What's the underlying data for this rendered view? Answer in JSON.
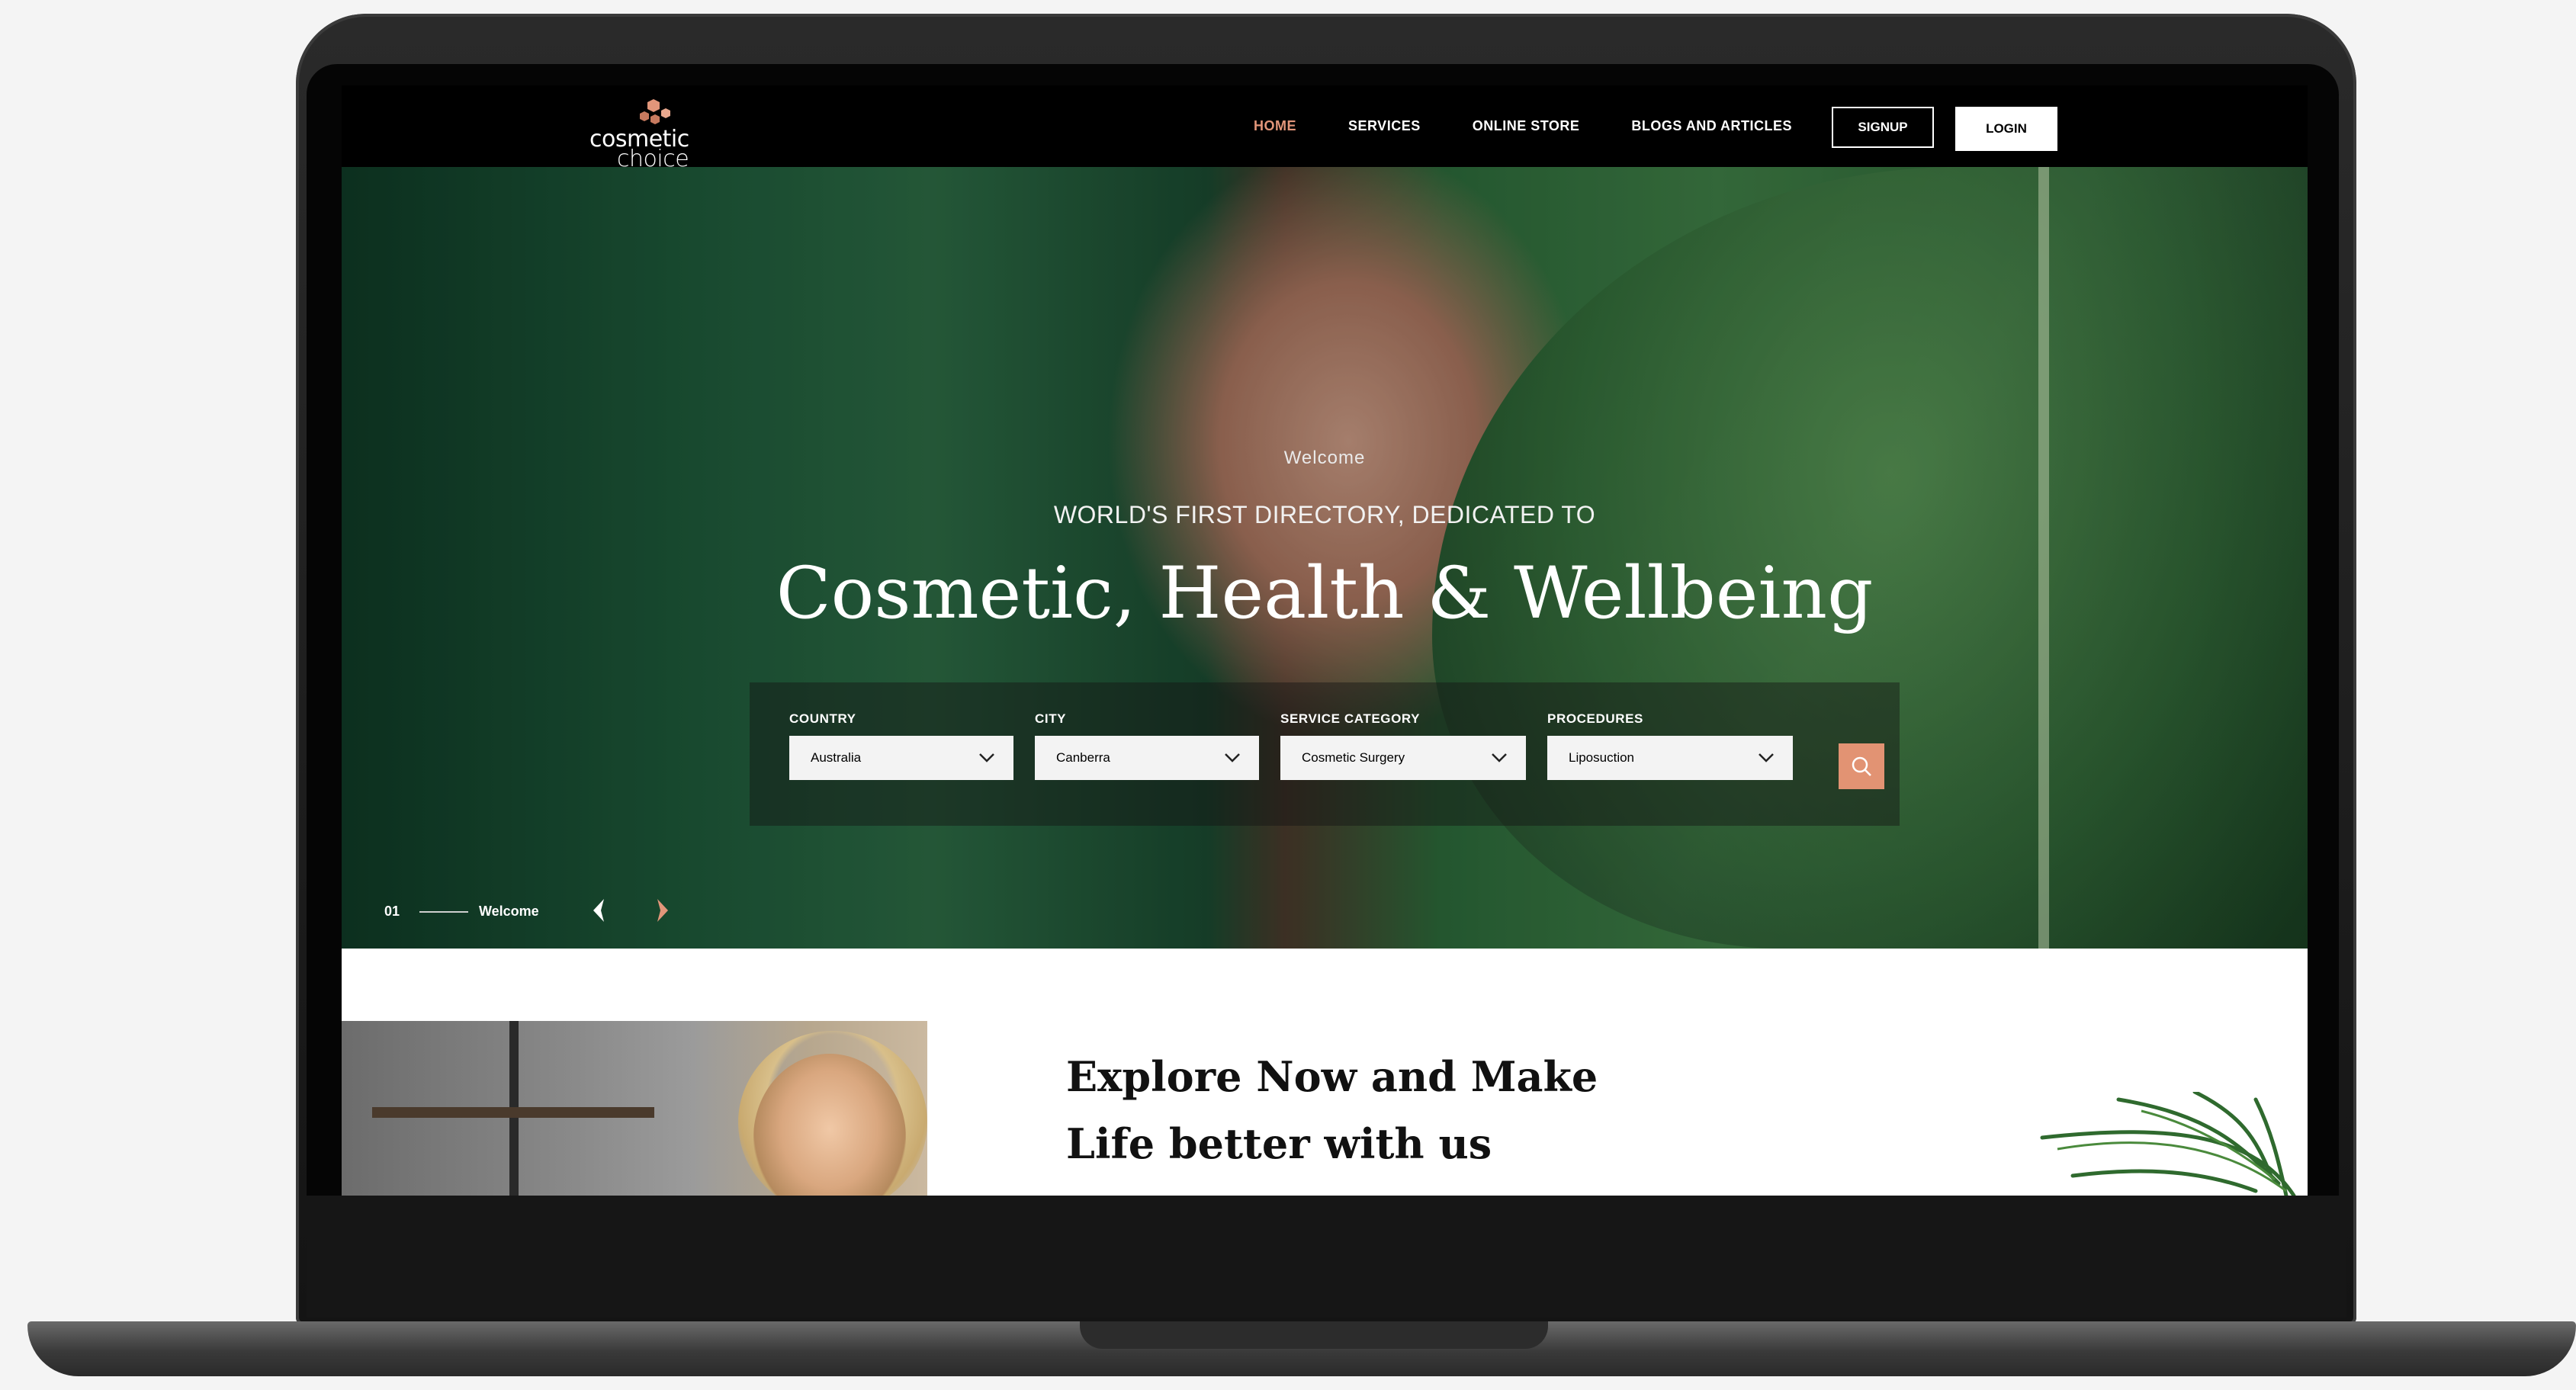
{
  "brand": {
    "logo_line1": "cosmetic",
    "logo_line2": "choice",
    "accent_color": "#e2967a"
  },
  "nav": {
    "items": [
      {
        "label": "HOME",
        "active": true
      },
      {
        "label": "SERVICES",
        "active": false
      },
      {
        "label": "ONLINE STORE",
        "active": false
      },
      {
        "label": "BLOGS AND ARTICLES",
        "active": false
      }
    ],
    "signup_label": "SIGNUP",
    "login_label": "LOGIN"
  },
  "hero": {
    "welcome": "Welcome",
    "subtitle": "WORLD'S FIRST DIRECTORY, DEDICATED TO",
    "title": "Cosmetic, Health & Wellbeing"
  },
  "search": {
    "fields": [
      {
        "label": "COUNTRY",
        "value": "Australia"
      },
      {
        "label": "CITY",
        "value": "Canberra"
      },
      {
        "label": "SERVICE CATEGORY",
        "value": "Cosmetic Surgery"
      },
      {
        "label": "PROCEDURES",
        "value": "Liposuction"
      }
    ],
    "button_icon": "search-icon",
    "button_color": "#e29373"
  },
  "slider": {
    "index": "01",
    "label": "Welcome",
    "prev_icon": "chevron-left-icon",
    "next_icon": "chevron-right-icon"
  },
  "explore": {
    "line1": "Explore Now and Make",
    "line2": "Life better with us"
  }
}
